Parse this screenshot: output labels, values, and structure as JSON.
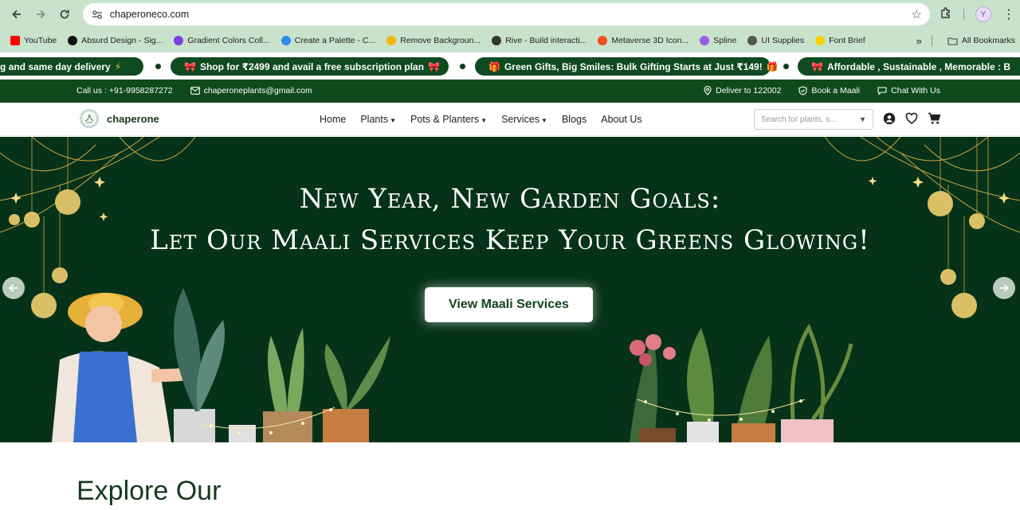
{
  "browser": {
    "url": "chaperoneco.com",
    "profile_initial": "Y",
    "bookmarks": [
      {
        "label": "YouTube",
        "color": "#ff0000"
      },
      {
        "label": "Absurd Design - Sig...",
        "color": "#111111"
      },
      {
        "label": "Gradient Colors Coll...",
        "color": "#7b3fe4"
      },
      {
        "label": "Create a Palette - C...",
        "color": "#2d8cf0"
      },
      {
        "label": "Remove Backgroun...",
        "color": "#f2b705"
      },
      {
        "label": "Rive - Build interacti...",
        "color": "#333333"
      },
      {
        "label": "Metaverse 3D Icon...",
        "color": "#f24e1e"
      },
      {
        "label": "Spline",
        "color": "#9b5de5"
      },
      {
        "label": "UI Supplies",
        "color": "#555555"
      },
      {
        "label": "Font Brief",
        "color": "#f7d000"
      }
    ],
    "all_bookmarks": "All Bookmarks"
  },
  "marquee": {
    "items": [
      {
        "pre": "",
        "text": "g  and  same day delivery",
        "post": "⚡"
      },
      {
        "pre": "🎀",
        "text": "Shop for  ₹2499  and avail a  free subscription plan",
        "post": "🎀"
      },
      {
        "pre": "🎁",
        "text": "Green Gifts, Big Smiles: Bulk Gifting Starts at Just ₹149!",
        "post": "🎁"
      },
      {
        "pre": "🎀",
        "text": "Affordable  ,  Sustainable  ,  Memorable  : B",
        "post": ""
      }
    ]
  },
  "infobar": {
    "call": "Call us : +91-9958287272",
    "email": "chaperoneplants@gmail.com",
    "deliver": "Deliver to 122002",
    "book": "Book a Maali",
    "chat": "Chat With Us"
  },
  "header": {
    "logo_text": "chaperone",
    "logo_mark": "Chaperone",
    "nav": [
      {
        "label": "Home",
        "dropdown": false
      },
      {
        "label": "Plants",
        "dropdown": true
      },
      {
        "label": "Pots & Planters",
        "dropdown": true
      },
      {
        "label": "Services",
        "dropdown": true
      },
      {
        "label": "Blogs",
        "dropdown": false
      },
      {
        "label": "About Us",
        "dropdown": false
      }
    ],
    "search_placeholder": "Search for plants, s..."
  },
  "hero": {
    "line1": "New Year, New Garden Goals:",
    "line2": "Let Our Maali Services Keep Your Greens Glowing!",
    "cta": "View Maali Services",
    "bg_color": "#063219"
  },
  "section": {
    "title": "Explore Our"
  }
}
